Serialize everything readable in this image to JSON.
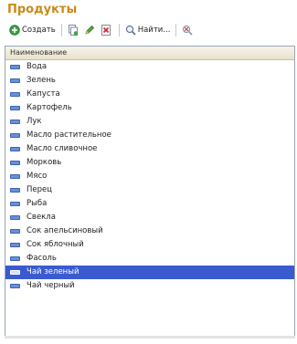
{
  "window": {
    "title": "Продукты"
  },
  "toolbar": {
    "create_label": "Создать",
    "find_label": "Найти..."
  },
  "table": {
    "header": "Наименование",
    "rows": [
      "Вода",
      "Зелень",
      "Капуста",
      "Картофель",
      "Лук",
      "Масло растительное",
      "Масло сливочное",
      "Морковь",
      "Мясо",
      "Перец",
      "Рыба",
      "Свекла",
      "Сок апельсиновый",
      "Сок яблочный",
      "Фасоль",
      "Чай зеленый",
      "Чай черный"
    ],
    "selected_row": "Чай зеленый"
  },
  "colors": {
    "title": "#c98a18",
    "selection": "#3a5bd0"
  }
}
